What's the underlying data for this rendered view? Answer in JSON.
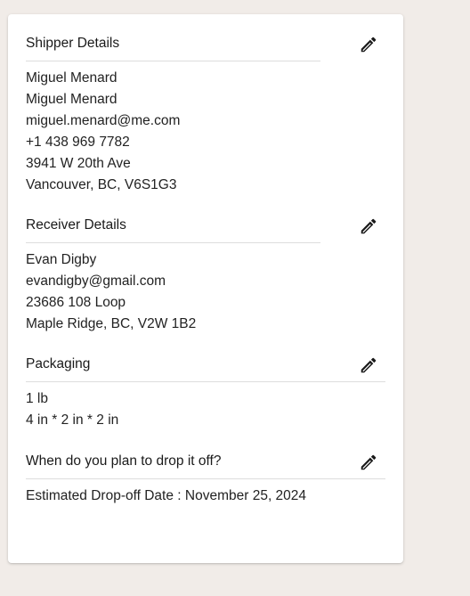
{
  "shipper": {
    "title": "Shipper Details",
    "lines": [
      "Miguel Menard",
      "Miguel Menard",
      "miguel.menard@me.com",
      "+1 438 969 7782",
      "3941 W 20th Ave",
      "Vancouver, BC, V6S1G3"
    ]
  },
  "receiver": {
    "title": "Receiver Details",
    "lines": [
      "Evan Digby",
      "evandigby@gmail.com",
      "23686 108 Loop",
      "Maple Ridge, BC, V2W 1B2"
    ]
  },
  "packaging": {
    "title": "Packaging",
    "lines": [
      "1 lb",
      "4 in * 2 in * 2 in"
    ]
  },
  "dropoff": {
    "title": "When do you plan to drop it off?",
    "lines": [
      "Estimated Drop-off Date : November 25, 2024"
    ]
  },
  "icons": {
    "edit": "pencil-icon"
  },
  "colors": {
    "page_background": "#f1ece8",
    "card_background": "#ffffff",
    "divider": "#dddddd",
    "text": "#1c1c1c"
  }
}
